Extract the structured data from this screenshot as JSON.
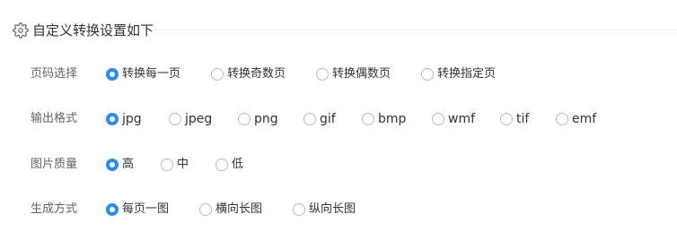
{
  "header": {
    "title": "自定义转换设置如下",
    "icon": "gear-icon",
    "icon_color": "#666666"
  },
  "accent_color": "#2d8cf0",
  "rows": [
    {
      "label": "页码选择",
      "options": [
        "转换每一页",
        "转换奇数页",
        "转换偶数页",
        "转换指定页"
      ],
      "selected": "转换每一页"
    },
    {
      "label": "输出格式",
      "options": [
        "jpg",
        "jpeg",
        "png",
        "gif",
        "bmp",
        "wmf",
        "tif",
        "emf"
      ],
      "selected": "jpg"
    },
    {
      "label": "图片质量",
      "options": [
        "高",
        "中",
        "低"
      ],
      "selected": "高"
    },
    {
      "label": "生成方式",
      "options": [
        "每页一图",
        "横向长图",
        "纵向长图"
      ],
      "selected": "每页一图"
    }
  ]
}
